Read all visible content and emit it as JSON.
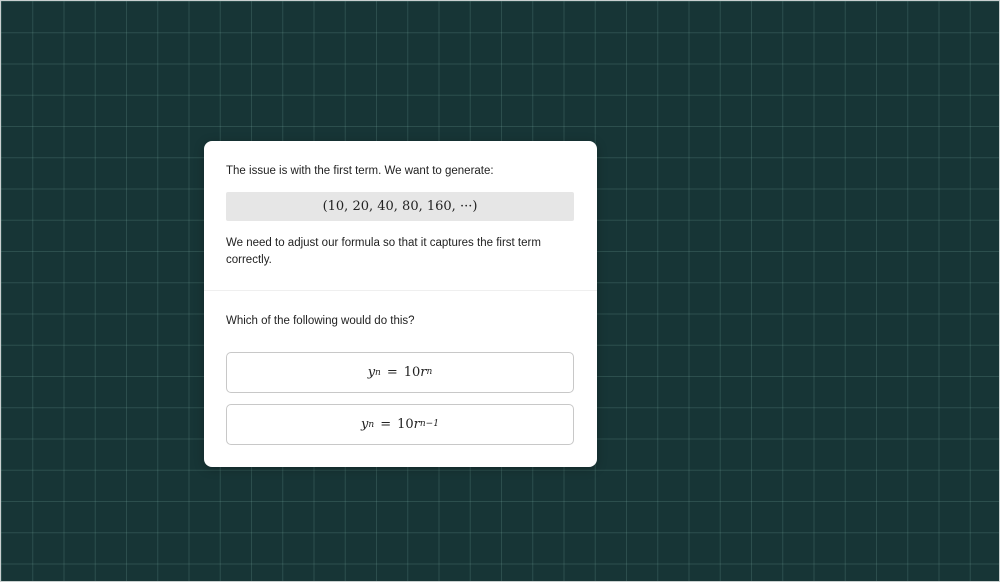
{
  "lesson": {
    "intro": "The issue is with the first term. We want to generate:",
    "sequence": "(10, 20, 40, 80, 160, ···)",
    "adjust": "We need to adjust our formula so that it captures the first term correctly.",
    "question": "Which of the following would do this?",
    "choices": [
      {
        "var": "y",
        "sub": "n",
        "eq": "=",
        "coef": "10",
        "base": "r",
        "exp": "n"
      },
      {
        "var": "y",
        "sub": "n",
        "eq": "=",
        "coef": "10",
        "base": "r",
        "exp": "n−1"
      }
    ]
  }
}
